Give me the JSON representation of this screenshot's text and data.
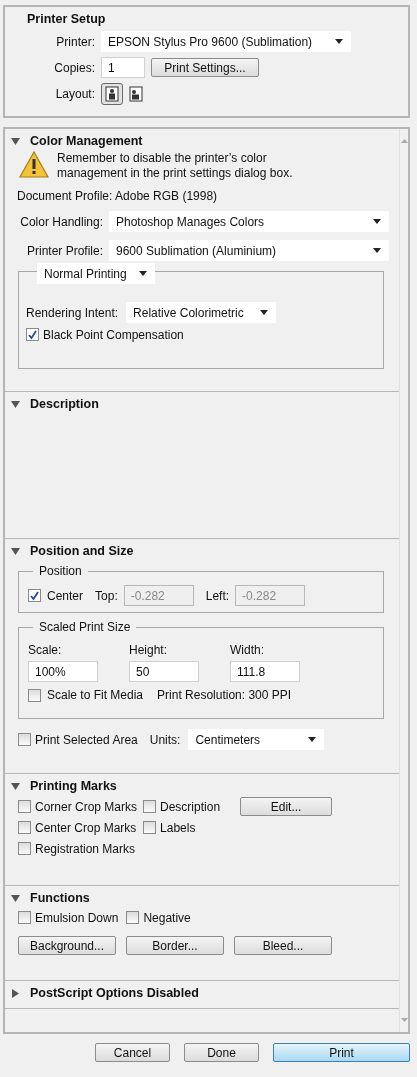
{
  "printer_setup": {
    "title": "Printer Setup",
    "printer": {
      "label": "Printer:",
      "value": "EPSON Stylus Pro 9600 (Sublimation)"
    },
    "copies": {
      "label": "Copies:",
      "value": "1"
    },
    "print_settings_button": "Print Settings...",
    "layout": {
      "label": "Layout:",
      "options": [
        {
          "kind": "portrait",
          "selected": true
        },
        {
          "kind": "landscape",
          "selected": false
        }
      ]
    }
  },
  "color_management": {
    "title": "Color Management",
    "expanded": true,
    "warning": "Remember to disable the printer’s color management in the print settings dialog box.",
    "document_profile": "Document Profile: Adobe RGB (1998)",
    "color_handling": {
      "label": "Color Handling:",
      "value": "Photoshop Manages Colors"
    },
    "printer_profile": {
      "label": "Printer Profile:",
      "value": "9600 Sublimation (Aluminium)"
    },
    "mode": "Normal Printing",
    "rendering_intent": {
      "label": "Rendering Intent:",
      "value": "Relative Colorimetric"
    },
    "black_point": {
      "label": "Black Point Compensation",
      "checked": true
    }
  },
  "description": {
    "title": "Description",
    "expanded": true
  },
  "position_and_size": {
    "title": "Position and Size",
    "expanded": true,
    "position": {
      "title": "Position",
      "center": {
        "label": "Center",
        "checked": true
      },
      "fields": [
        {
          "label": "Top:",
          "value": "-0.282",
          "disabled": true
        },
        {
          "label": "Left:",
          "value": "-0.282",
          "disabled": true
        }
      ]
    },
    "scaled_print_size": {
      "title": "Scaled Print Size",
      "fields": [
        {
          "label": "Scale:",
          "value": "100%"
        },
        {
          "label": "Height:",
          "value": "50"
        },
        {
          "label": "Width:",
          "value": "111.8"
        }
      ],
      "scale_to_fit": {
        "label": "Scale to Fit Media",
        "checked": false
      },
      "resolution": "Print Resolution: 300 PPI"
    },
    "print_selected_area": {
      "label": "Print Selected Area",
      "checked": false
    },
    "units": {
      "label": "Units:",
      "value": "Centimeters"
    }
  },
  "printing_marks": {
    "title": "Printing Marks",
    "expanded": true,
    "column_1": [
      {
        "label": "Corner Crop Marks",
        "checked": false
      },
      {
        "label": "Center Crop Marks",
        "checked": false
      },
      {
        "label": "Registration Marks",
        "checked": false
      }
    ],
    "column_2": [
      {
        "label": "Description",
        "checked": false
      },
      {
        "label": "Labels",
        "checked": false
      }
    ],
    "edit_button": "Edit..."
  },
  "functions": {
    "title": "Functions",
    "expanded": true,
    "checkboxes": [
      {
        "label": "Emulsion Down",
        "checked": false
      },
      {
        "label": "Negative",
        "checked": false
      }
    ],
    "buttons": [
      "Background...",
      "Border...",
      "Bleed..."
    ]
  },
  "postscript": {
    "title": "PostScript Options Disabled",
    "expanded": false
  },
  "buttons": [
    {
      "label": "Cancel",
      "kind": "normal"
    },
    {
      "label": "Done",
      "kind": "normal"
    },
    {
      "label": "Print",
      "kind": "default"
    }
  ]
}
